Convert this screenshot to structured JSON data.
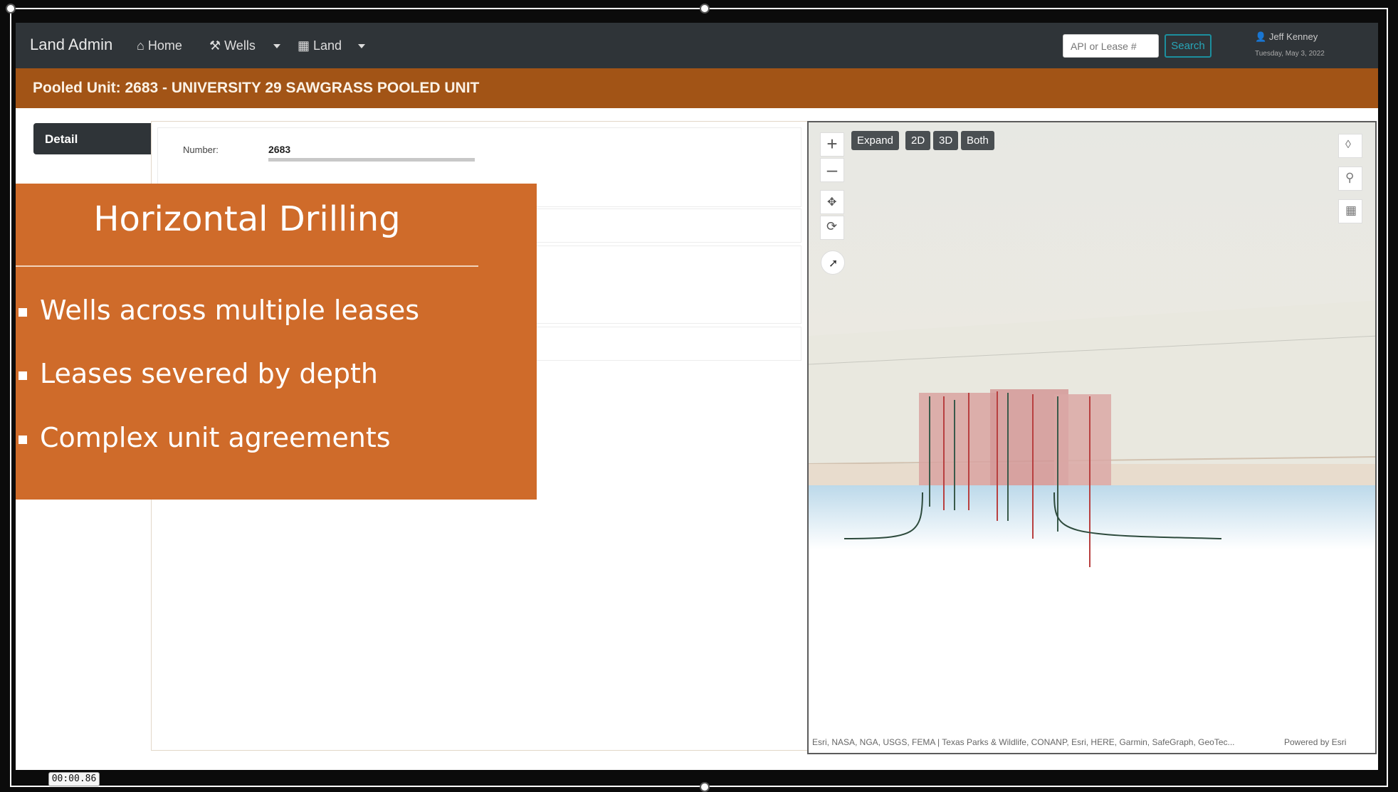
{
  "navbar": {
    "brand": "Land Admin",
    "home": "Home",
    "wells": "Wells",
    "land": "Land",
    "search_placeholder": "API or Lease #",
    "search_button": "Search",
    "user_name": "Jeff Kenney",
    "date": "Tuesday, May 3, 2022"
  },
  "header": {
    "title": "Pooled Unit: 2683 - UNIVERSITY 29 SAWGRASS POOLED UNIT"
  },
  "sidebar": {
    "detail_tab": "Detail"
  },
  "detail": {
    "number_label": "Number:",
    "number_value": "2683"
  },
  "map": {
    "buttons": [
      "Expand",
      "2D",
      "3D",
      "Both"
    ],
    "attribution": "Esri, NASA, NGA, USGS, FEMA | Texas Parks & Wildlife, CONANP, Esri, HERE, Garmin, SafeGraph, GeoTec...",
    "powered_by": "Powered by Esri"
  },
  "slide": {
    "title": "Horizontal Drilling",
    "bullets": [
      "Wells across multiple leases",
      "Leases severed by depth",
      "Complex unit agreements"
    ]
  },
  "recorder": {
    "timestamp": "00:00.86"
  }
}
